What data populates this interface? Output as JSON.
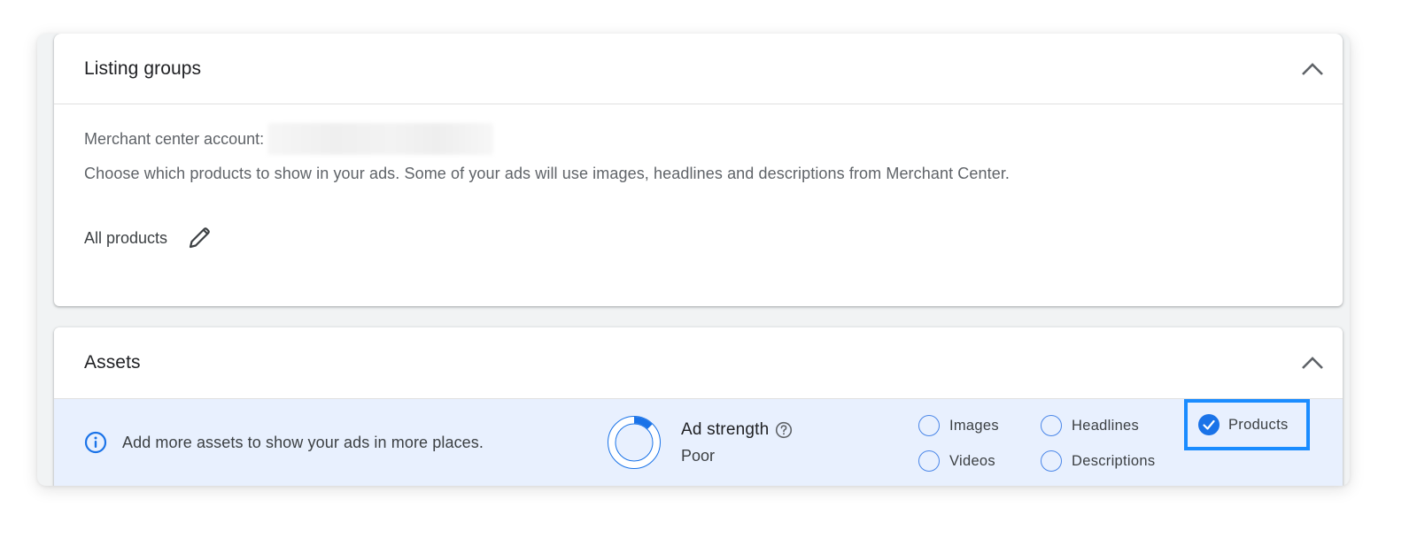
{
  "listing_groups": {
    "title": "Listing groups",
    "collapse_icon": "chevron-up-icon",
    "merchant_label": "Merchant center account:",
    "merchant_value_redacted": true,
    "description": "Choose which products to show in your ads. Some of your ads will use images, headlines and descriptions from Merchant Center.",
    "selection_label": "All products",
    "edit_icon": "pencil-icon"
  },
  "assets": {
    "title": "Assets",
    "collapse_icon": "chevron-up-icon",
    "banner": {
      "info_icon": "info-icon",
      "message": "Add more assets to show your ads in more places."
    },
    "ad_strength": {
      "label": "Ad strength",
      "help_icon": "help-circle-icon",
      "value": "Poor",
      "gauge_fraction": 0.125
    },
    "checklist": [
      {
        "label": "Images",
        "checked": false
      },
      {
        "label": "Headlines",
        "checked": false
      },
      {
        "label": "Products",
        "checked": true,
        "highlighted": true
      },
      {
        "label": "Videos",
        "checked": false
      },
      {
        "label": "Descriptions",
        "checked": false
      }
    ]
  },
  "colors": {
    "accent_blue": "#1a73e8",
    "highlight_blue": "#1a8cff",
    "banner_bg": "#e8f0fe",
    "page_bg": "#f1f3f4"
  }
}
